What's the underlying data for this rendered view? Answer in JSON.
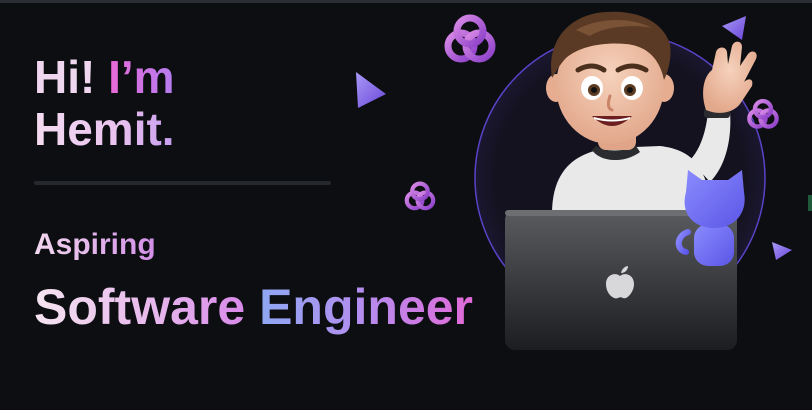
{
  "hero": {
    "greeting": "Hi! ",
    "greeting_accent": "I’m",
    "name": "Hemit.",
    "aspiring": "Aspiring",
    "role_first": "Software",
    "role_second": "Engineer"
  },
  "colors": {
    "background": "#0c0e12",
    "accent_pink": "#e86ad6",
    "accent_purple": "#9a63e8",
    "accent_blue": "#8ea7f2",
    "mascot_blue": "#6f6cf4"
  },
  "icons": {
    "decor": [
      "knot-icon",
      "triangle-icon",
      "avatar-illustration",
      "laptop-icon",
      "apple-logo-icon",
      "octocat-icon"
    ]
  }
}
